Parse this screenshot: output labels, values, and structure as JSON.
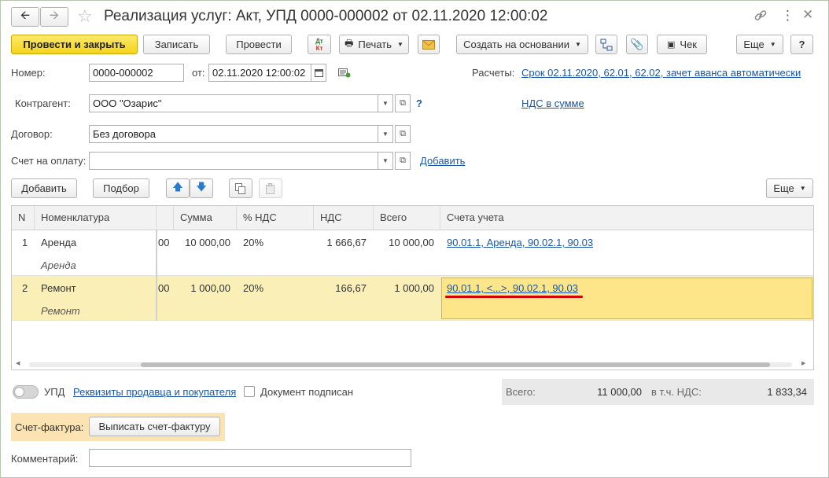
{
  "window": {
    "title": "Реализация услуг: Акт, УПД 0000-000002 от 02.11.2020 12:00:02"
  },
  "toolbar": {
    "post_close": "Провести и закрыть",
    "save": "Записать",
    "post": "Провести",
    "dt_kt_top": "Дт",
    "dt_kt_bottom": "Кт",
    "print": "Печать",
    "create_based": "Создать на основании",
    "receipt": "Чек",
    "more": "Еще",
    "help": "?"
  },
  "form": {
    "number_label": "Номер:",
    "number_value": "0000-000002",
    "from_label": "от:",
    "date_value": "02.11.2020 12:00:02",
    "settlements_label": "Расчеты:",
    "settlements_link": "Срок 02.11.2020, 62.01, 62.02, зачет аванса автоматически",
    "counterparty_label": "Контрагент:",
    "counterparty_value": "ООО \"Озарис\"",
    "help_mark": "?",
    "vat_link": "НДС в сумме",
    "contract_label": "Договор:",
    "contract_value": "Без договора",
    "invoice_label": "Счет на оплату:",
    "invoice_value": "",
    "add_link": "Добавить"
  },
  "table_toolbar": {
    "add": "Добавить",
    "pick": "Подбор",
    "more": "Еще"
  },
  "table": {
    "headers": {
      "n": "N",
      "item": "Номенклатура",
      "amount": "Сумма",
      "vat_rate": "% НДС",
      "vat": "НДС",
      "total": "Всего",
      "accounts": "Счета учета"
    },
    "rows": [
      {
        "n": "1",
        "item": "Аренда",
        "item_sub": "Аренда",
        "cut": "00",
        "amount": "10 000,00",
        "vat_rate": "20%",
        "vat": "1 666,67",
        "total": "10 000,00",
        "accounts": "90.01.1, Аренда, 90.02.1, 90.03"
      },
      {
        "n": "2",
        "item": "Ремонт",
        "item_sub": "Ремонт",
        "cut": "00",
        "amount": "1 000,00",
        "vat_rate": "20%",
        "vat": "166,67",
        "total": "1 000,00",
        "accounts": "90.01.1, <...>, 90.02.1, 90.03"
      }
    ]
  },
  "footer": {
    "upd_label": "УПД",
    "requisites_link": "Реквизиты продавца и покупателя",
    "signed_label": "Документ подписан",
    "total_label": "Всего:",
    "total_value": "11 000,00",
    "vat_label": "в т.ч. НДС:",
    "vat_value": "1 833,34",
    "invoice_doc_label": "Счет-фактура:",
    "issue_invoice": "Выписать счет-фактуру",
    "comment_label": "Комментарий:",
    "comment_value": ""
  },
  "colors": {
    "primary_button": "#f5d31a",
    "selected_row": "#fbefb8",
    "selected_cell": "#fde68a",
    "link": "#1b56a6",
    "highlight_underline": "#d40000"
  }
}
